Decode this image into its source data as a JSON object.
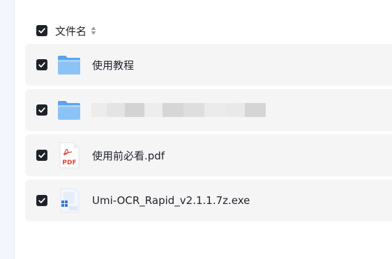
{
  "header": {
    "select_all_checked": true,
    "column_label": "文件名"
  },
  "files": [
    {
      "name": "使用教程",
      "type": "folder",
      "checked": true
    },
    {
      "name": "",
      "type": "folder",
      "checked": true,
      "name_redacted": true
    },
    {
      "name": "使用前必看.pdf",
      "type": "pdf",
      "checked": true
    },
    {
      "name": "Umi-OCR_Rapid_v2.1.1.7z.exe",
      "type": "exe",
      "checked": true
    }
  ],
  "colors": {
    "checkbox": "#1f2329",
    "row_bg": "#f5f5f6",
    "folder": "#6fb3f5",
    "pdf_red": "#e0453b"
  },
  "icons": {
    "folder": "folder-icon",
    "pdf": "pdf-file-icon",
    "exe": "installer-file-icon",
    "sort": "sort-icon",
    "check": "check-icon"
  }
}
